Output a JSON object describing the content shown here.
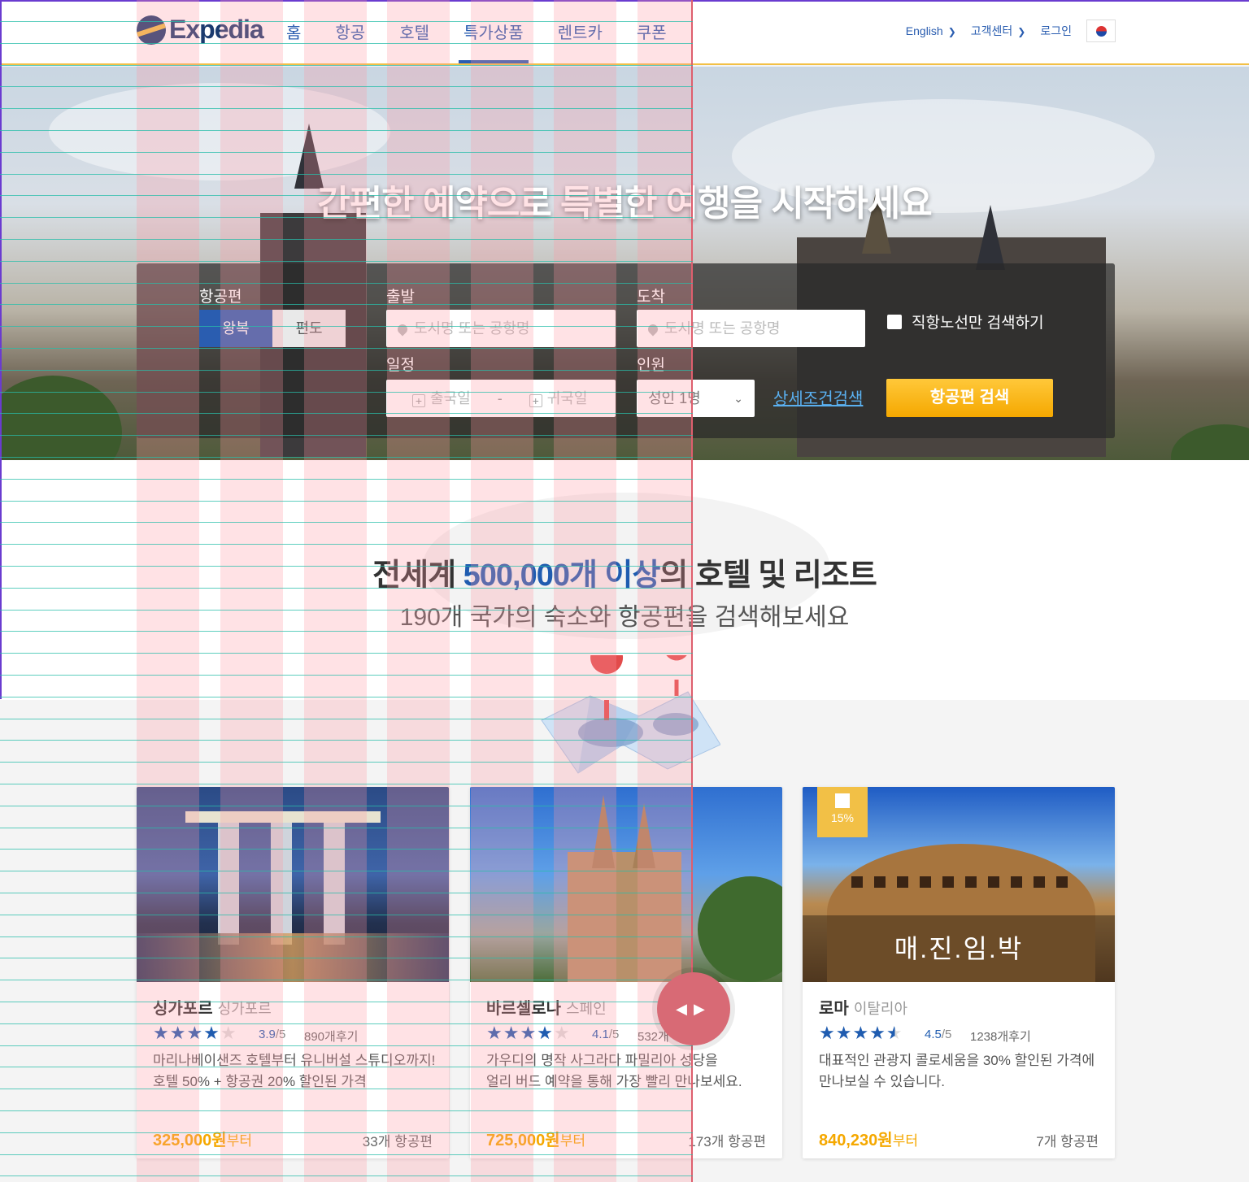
{
  "header": {
    "logo": "Expedia",
    "nav": [
      "홈",
      "항공",
      "호텔",
      "특가상품",
      "렌트카",
      "쿠폰"
    ],
    "active_nav": "특가상품",
    "language": "English",
    "support": "고객센터",
    "login": "로그인"
  },
  "hero": {
    "title": "간편한 예약으로 특별한 여행을 시작하세요"
  },
  "search": {
    "flight_label": "항공편",
    "trip_roundtrip": "왕복",
    "trip_oneway": "편도",
    "depart_label": "출발",
    "depart_placeholder": "도시명 또는 공항명",
    "arrive_label": "도착",
    "arrive_placeholder": "도시명 또는 공항명",
    "direct_only": "직항노선만 검색하기",
    "schedule_label": "일정",
    "depart_date": "출국일",
    "date_separator": "-",
    "return_date": "귀국일",
    "passengers_label": "인원",
    "passengers_value": "성인 1명",
    "advanced": "상세조건검색",
    "submit": "항공편 검색"
  },
  "promo": {
    "title_pre": "전세계 ",
    "title_highlight": "500,000개 이상",
    "title_post": "의 호텔 및 리조트",
    "subtitle": "190개 국가의 숙소와 항공편을 검색해보세요"
  },
  "cards": [
    {
      "city": "싱가포르",
      "country": "싱가포르",
      "stars": 4,
      "rating": "3.9",
      "rating_max": "/5",
      "reviews": "890개후기",
      "desc1": "마리나베이샌즈 호텔부터 유니버설 스튜디오까지!",
      "desc2": "호텔 50% + 항공권 20% 할인된 가격",
      "price": "325,000원",
      "price_suffix": "부터",
      "flights": "33개 항공편"
    },
    {
      "city": "바르셀로나",
      "country": "스페인",
      "stars": 4,
      "rating": "4.1",
      "rating_max": "/5",
      "reviews": "532개",
      "desc1": "가우디의 명작 사그라다 파밀리아 성당을",
      "desc2": "얼리 버드 예약을 통해 가장 빨리 만나보세요.",
      "price": "725,000원",
      "price_suffix": "부터",
      "flights": "173개 항공편"
    },
    {
      "city": "로마",
      "country": "이탈리아",
      "stars": 4.5,
      "rating": "4.5",
      "rating_max": "/5",
      "reviews": "1238개후기",
      "desc1": "대표적인 관광지 콜로세움을 30% 할인된 가격에",
      "desc2": "만나보실 수 있습니다.",
      "price": "840,230원",
      "price_suffix": "부터",
      "flights": "7개 항공편",
      "badge": "15%",
      "overlay": "매.진.임.박"
    }
  ],
  "colors": {
    "brand_blue": "#1f5cb0",
    "accent_yellow": "#f5a800",
    "guide_red": "#d24a5a",
    "guide_teal": "#28beaa"
  }
}
